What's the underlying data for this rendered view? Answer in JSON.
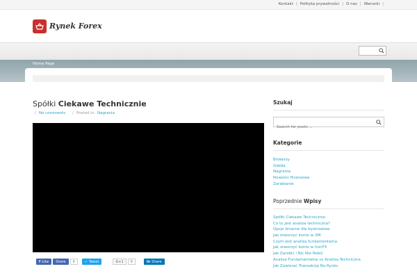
{
  "top_nav": [
    "Kontakt",
    "Polityka prywatności",
    "O nas",
    "Warunki"
  ],
  "logo": {
    "text": "Rynek Forex",
    "brand_color": "#c9302c"
  },
  "breadcrumb": "Home Page",
  "post": {
    "title_light": "Spółki",
    "title_bold": "Ciekawe Technicznie",
    "comments": "No comments",
    "posted_in_label": "Posted in:",
    "category": "Nagrania"
  },
  "share": {
    "like": "Like",
    "share": "Share",
    "share_count": "0",
    "tweet": "Tweet",
    "gplus": "G+1",
    "gplus_count": "0",
    "linkedin_share": "Share"
  },
  "sidebar": {
    "search_title": "Szukaj",
    "search_placeholder": "Search for posts ...",
    "categories_title": "Kategorie",
    "categories": [
      "Brokerzy",
      "Giełda",
      "Nagrania",
      "Nowości finansowe",
      "Zarabianie"
    ],
    "recent_title_light": "Poprzednie",
    "recent_title_bold": "Wpisy",
    "recent": [
      "Spółki Ciekawe Technicznie",
      "Co to jest analiza techniczna?",
      "Opcje binarne dla bystrzaków",
      "Jak otworzyć konto w XM",
      "Czym jest analiza fundamentalna",
      "Jak otworzyć konto w IronFX",
      "Jak Zarobić i Nic Nie Robić",
      "Analiza Fundamentalna vs Analiza Techniczna",
      "Jak Zawierać Transakcję Na Rynku"
    ]
  },
  "colors": {
    "link": "#2aa4c8",
    "band": "#9fb2b7"
  }
}
